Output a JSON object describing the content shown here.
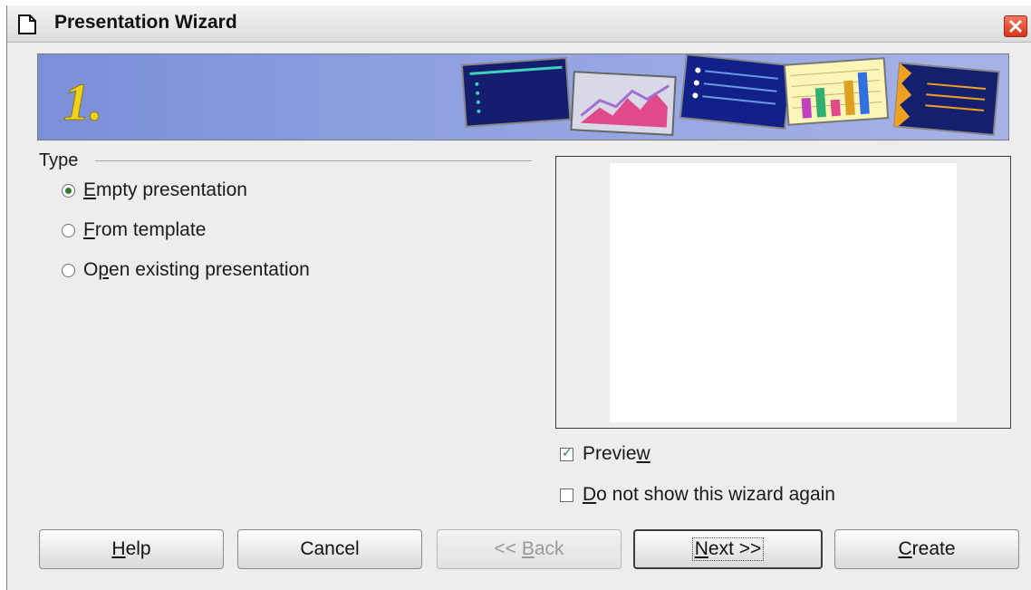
{
  "window": {
    "title": "Presentation Wizard"
  },
  "banner": {
    "step_number": "1."
  },
  "type_section": {
    "label": "Type",
    "options": [
      {
        "mnemonic": "E",
        "rest": "mpty presentation",
        "checked": true
      },
      {
        "mnemonic": "F",
        "rest": "rom template",
        "checked": false
      },
      {
        "pre": "O",
        "mnemonic": "p",
        "rest": "en existing presentation",
        "checked": false
      }
    ]
  },
  "preview_checkbox": {
    "pre": "Previe",
    "mnemonic": "w",
    "checked": true
  },
  "dont_show_checkbox": {
    "mnemonic": "D",
    "rest": "o not show this wizard again",
    "checked": false
  },
  "buttons": {
    "help": {
      "mnemonic": "H",
      "rest": "elp"
    },
    "cancel": {
      "label": "Cancel"
    },
    "back": {
      "pre": "<< ",
      "mnemonic": "B",
      "rest": "ack",
      "enabled": false
    },
    "next": {
      "mnemonic": "N",
      "rest": "ext >>",
      "default": true
    },
    "create": {
      "mnemonic": "C",
      "rest": "reate"
    }
  },
  "colors": {
    "banner_bg": "#8fa0e0",
    "step_number": "#f2d21a",
    "close_button": "#d83418",
    "radio_dot": "#2f7a2f"
  }
}
